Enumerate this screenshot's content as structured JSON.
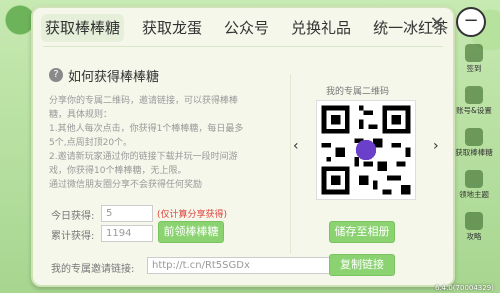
{
  "tabs": [
    "获取棒棒糖",
    "获取龙蛋",
    "公众号",
    "兑换礼品",
    "统一冰红茶"
  ],
  "how_to": {
    "title": "如何获得棒棒糖",
    "lines": [
      "分享你的专属二维码，邀请链接，可以获得棒棒",
      "糖，具体规则：",
      "1.其他人每次点击，你获得1个棒棒糖，每日最多",
      "5个,点周封顶20个。",
      "2.邀请新玩家通过你的链接下载并玩一段时间游",
      "戏，你获得10个棒棒糖，无上限。",
      "通过微信朋友圈分享不会获得任何奖励"
    ]
  },
  "qr": {
    "title": "我的专属二维码"
  },
  "today": {
    "label": "今日获得:",
    "value": "5",
    "hint": "(仅计算分享获得)"
  },
  "total": {
    "label": "累计获得:",
    "value": "1194"
  },
  "buttons": {
    "claim": "前领棒棒糖",
    "save_album": "储存至相册",
    "copy_link": "复制链接"
  },
  "invite": {
    "label": "我的专属邀请链接:",
    "value": "http://t.cn/Rt5SGDx"
  },
  "side": [
    {
      "label": "签到"
    },
    {
      "label": "账号&设置"
    },
    {
      "label": "获取棒棒糖"
    },
    {
      "label": "领地主题"
    },
    {
      "label": "攻略"
    }
  ],
  "version": "6.4.0(70004329)"
}
